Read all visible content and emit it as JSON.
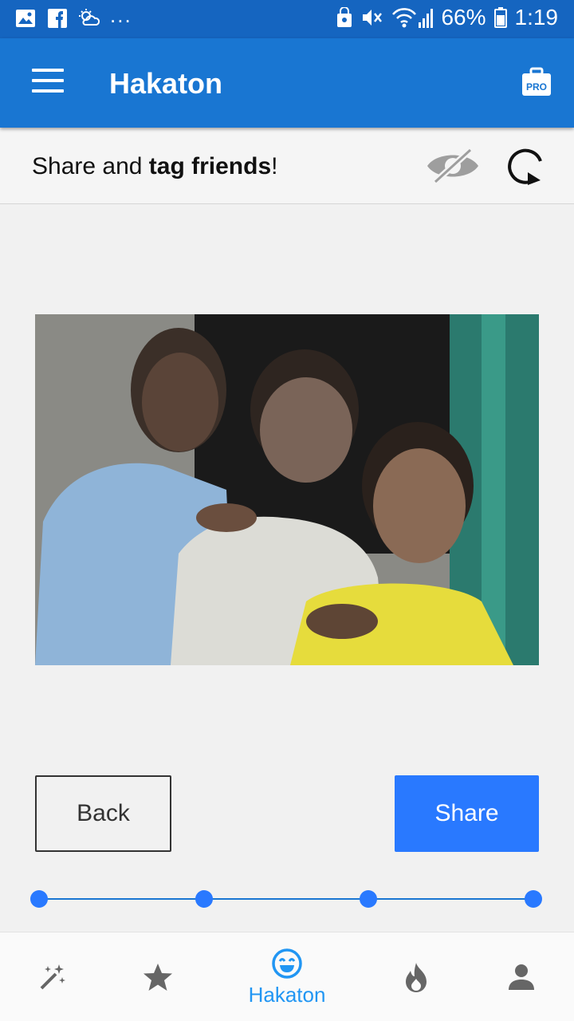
{
  "status_bar": {
    "left_icons": [
      "gallery-icon",
      "facebook-icon",
      "weather-icon"
    ],
    "overflow": "...",
    "battery": "66%",
    "time": "1:19"
  },
  "app_bar": {
    "title": "Hakaton",
    "pro_badge": "PRO"
  },
  "sub_header": {
    "text_before": "Share and ",
    "text_bold": "tag friends",
    "text_after": "!"
  },
  "photo": {
    "description_icon": "photo-icon"
  },
  "actions": {
    "back_label": "Back",
    "share_label": "Share"
  },
  "stepper": {
    "steps": 4,
    "current": 4
  },
  "bottom_nav": {
    "items": [
      {
        "icon": "magic-wand-icon",
        "label": ""
      },
      {
        "icon": "star-icon",
        "label": ""
      },
      {
        "icon": "smiley-icon",
        "label": "Hakaton",
        "active": true
      },
      {
        "icon": "fire-icon",
        "label": ""
      },
      {
        "icon": "person-icon",
        "label": ""
      }
    ]
  },
  "colors": {
    "status_bar": "#1565c0",
    "app_bar": "#1976d2",
    "accent": "#2979ff",
    "nav_active": "#2196f3"
  }
}
